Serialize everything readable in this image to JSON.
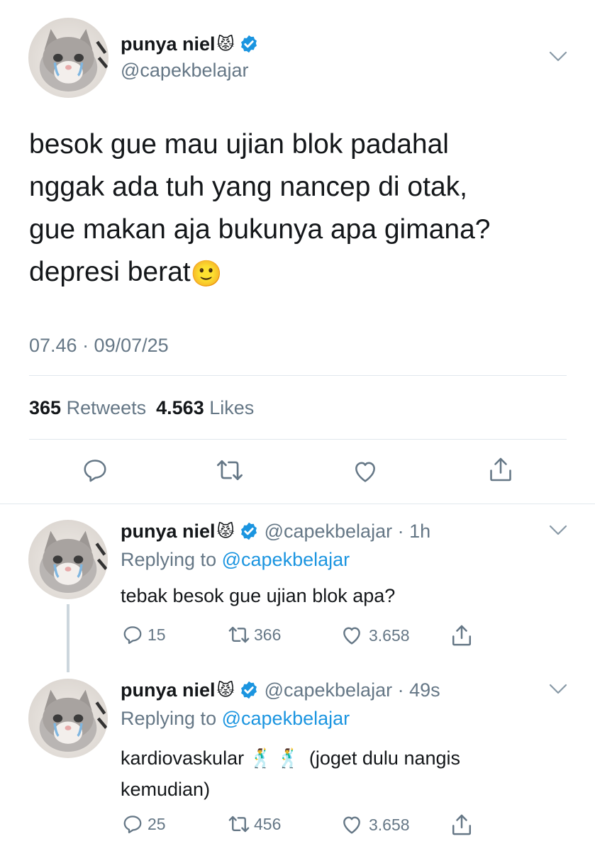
{
  "main_tweet": {
    "display_name": "punya niel",
    "name_emoji": "😾",
    "handle": "@capekbelajar",
    "text_lines": [
      "besok gue mau ujian blok padahal",
      "nggak ada tuh yang nancep di otak,",
      "gue makan aja bukunya apa gimana?",
      "depresi berat"
    ],
    "text_emoji": "🙂",
    "timestamp": "07.46 · 09/07/25",
    "retweets_count": "365",
    "retweets_label": "Retweets",
    "likes_count": "4.563",
    "likes_label": "Likes"
  },
  "replies": [
    {
      "display_name": "punya niel",
      "name_emoji": "😾",
      "handle_time": "@capekbelajar · 1h",
      "replying_label": "Replying to",
      "replying_handle": "@capekbelajar",
      "text_lines": [
        "tebak besok gue ujian blok apa?"
      ],
      "reply_count": "15",
      "retweet_count": "366",
      "like_count": "3.658"
    },
    {
      "display_name": "punya niel",
      "name_emoji": "😾",
      "handle_time": "@capekbelajar · 49s",
      "replying_label": "Replying to",
      "replying_handle": "@capekbelajar",
      "text_first": "kardiovaskular",
      "text_emojis": "🕺🕺",
      "text_rest": "(joget dulu nangis",
      "text_line2": "kemudian)",
      "reply_count": "25",
      "retweet_count": "456",
      "like_count": "3.658"
    }
  ],
  "icons": {
    "reply": "reply-icon",
    "retweet": "retweet-icon",
    "like": "heart-icon",
    "share": "share-icon",
    "verified": "verified-badge-icon",
    "more": "chevron-down-icon"
  },
  "colors": {
    "accent": "#1b95e0",
    "text": "#14171a",
    "secondary": "#657786",
    "divider": "#e1e8ed"
  }
}
